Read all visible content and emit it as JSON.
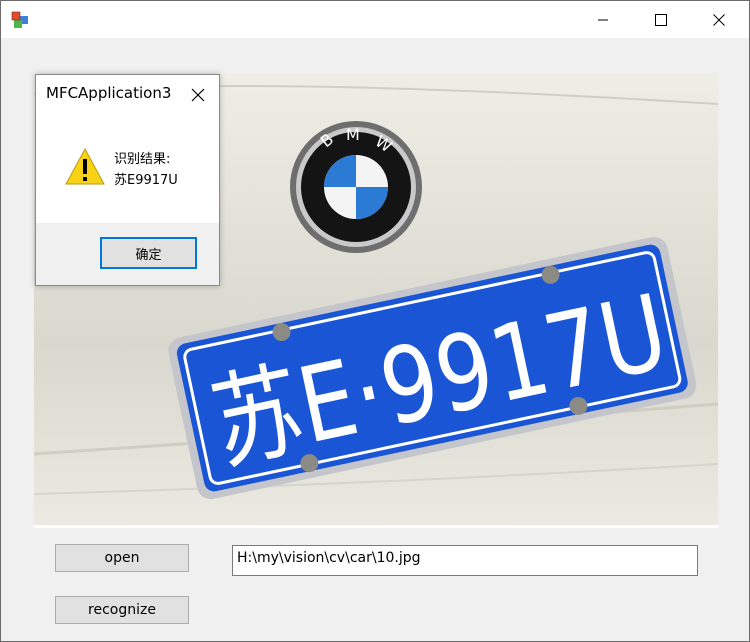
{
  "window": {
    "title": "",
    "icon": "mfc-app-icon",
    "controls": [
      "minimize-icon",
      "maximize-icon",
      "close-icon"
    ]
  },
  "image_view": {
    "description_icon": "car-plate-photo",
    "plate_text": "苏E·9917U",
    "badge_letters": [
      "B",
      "M",
      "W"
    ]
  },
  "buttons": {
    "open_label": "open",
    "recognize_label": "recognize"
  },
  "path_input": {
    "value": "H:\\my\\vision\\cv\\car\\10.jpg"
  },
  "dialog": {
    "title": "MFCApplication3",
    "icon": "warning-icon",
    "message_line1": "识别结果:",
    "message_line2": "苏E9917U",
    "ok_label": "确定"
  },
  "colors": {
    "plate_blue": "#1a55d6",
    "accent": "#0078d7",
    "warning_yellow": "#f7d217"
  }
}
